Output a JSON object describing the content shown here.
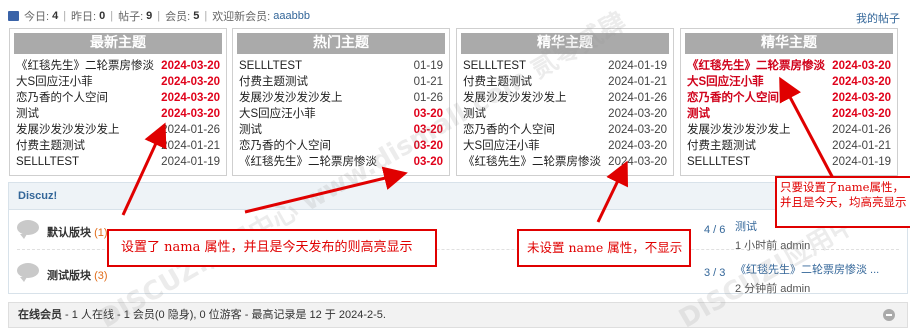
{
  "stats": {
    "today_label": "今日:",
    "today_value": "4",
    "yesterday_label": "昨日:",
    "yesterday_value": "0",
    "posts_label": "帖子:",
    "posts_value": "9",
    "members_label": "会员:",
    "members_value": "5",
    "welcome_label": "欢迎新会员:",
    "welcome_user": "aaabbb",
    "separator": "|"
  },
  "my_threads_link": "我的帖子",
  "panels": [
    {
      "title": "最新主题",
      "rows": [
        {
          "title": "《红毯先生》二轮票房惨淡",
          "date": "2024-03-20",
          "hl_date": true
        },
        {
          "title": "大S回应汪小菲",
          "date": "2024-03-20",
          "hl_date": true
        },
        {
          "title": "恋乃香的个人空间",
          "date": "2024-03-20",
          "hl_date": true
        },
        {
          "title": "测试",
          "date": "2024-03-20",
          "hl_date": true
        },
        {
          "title": "发展沙发沙发沙发上",
          "date": "2024-01-26",
          "hl_date": false
        },
        {
          "title": "付费主题测试",
          "date": "2024-01-21",
          "hl_date": false
        },
        {
          "title": "SELLLTEST",
          "date": "2024-01-19",
          "hl_date": false
        }
      ]
    },
    {
      "title": "热门主题",
      "rows": [
        {
          "title": "SELLLTEST",
          "date": "01-19",
          "hl_date": false
        },
        {
          "title": "付费主题测试",
          "date": "01-21",
          "hl_date": false
        },
        {
          "title": "发展沙发沙发沙发上",
          "date": "01-26",
          "hl_date": false
        },
        {
          "title": "大S回应汪小菲",
          "date": "03-20",
          "hl_date": true
        },
        {
          "title": "测试",
          "date": "03-20",
          "hl_date": true
        },
        {
          "title": "恋乃香的个人空间",
          "date": "03-20",
          "hl_date": true
        },
        {
          "title": "《红毯先生》二轮票房惨淡",
          "date": "03-20",
          "hl_date": true
        }
      ]
    },
    {
      "title": "精华主题",
      "rows": [
        {
          "title": "SELLLTEST",
          "date": "2024-01-19",
          "hl_date": false
        },
        {
          "title": "付费主题测试",
          "date": "2024-01-21",
          "hl_date": false
        },
        {
          "title": "发展沙发沙发沙发上",
          "date": "2024-01-26",
          "hl_date": false
        },
        {
          "title": "测试",
          "date": "2024-03-20",
          "hl_date": false
        },
        {
          "title": "恋乃香的个人空间",
          "date": "2024-03-20",
          "hl_date": false
        },
        {
          "title": "大S回应汪小菲",
          "date": "2024-03-20",
          "hl_date": false
        },
        {
          "title": "《红毯先生》二轮票房惨淡",
          "date": "2024-03-20",
          "hl_date": false
        }
      ]
    },
    {
      "title": "精华主题",
      "rows": [
        {
          "title": "《红毯先生》二轮票房惨淡",
          "date": "2024-03-20",
          "hl_title": true
        },
        {
          "title": "大S回应汪小菲",
          "date": "2024-03-20",
          "hl_title": true
        },
        {
          "title": "恋乃香的个人空间",
          "date": "2024-03-20",
          "hl_title": true
        },
        {
          "title": "测试",
          "date": "2024-03-20",
          "hl_title": true
        },
        {
          "title": "发展沙发沙发沙发上",
          "date": "2024-01-26",
          "hl_title": false
        },
        {
          "title": "付费主题测试",
          "date": "2024-01-21",
          "hl_title": false
        },
        {
          "title": "SELLLTEST",
          "date": "2024-01-19",
          "hl_title": false
        }
      ]
    }
  ],
  "forum": {
    "category": "Discuz!",
    "rows": [
      {
        "name": "默认版块",
        "count": "(1)",
        "stat": "4 / 6",
        "last_title": "测试",
        "last_meta": "1 小时前 admin"
      },
      {
        "name": "测试版块",
        "count": "(3)",
        "stat": "3 / 3",
        "last_title": "《红毯先生》二轮票房惨淡 ...",
        "last_meta": "2 分钟前 admin"
      }
    ]
  },
  "online": {
    "label": "在线会员",
    "text": " - 1 人在线 - 1 会员(0 隐身), 0 位游客 - 最高记录是 12 于 2024-2-5."
  },
  "annotations": {
    "left": "设置了 nama 属性，并且是今天发布的则高亮显示",
    "middle": "未设置 name 属性，不显示",
    "right": "只要设置了name属性，并且是今天，均高亮显示"
  },
  "watermark": "DISCUZ!应用中心 www.dismall.com 贰零贰肆"
}
